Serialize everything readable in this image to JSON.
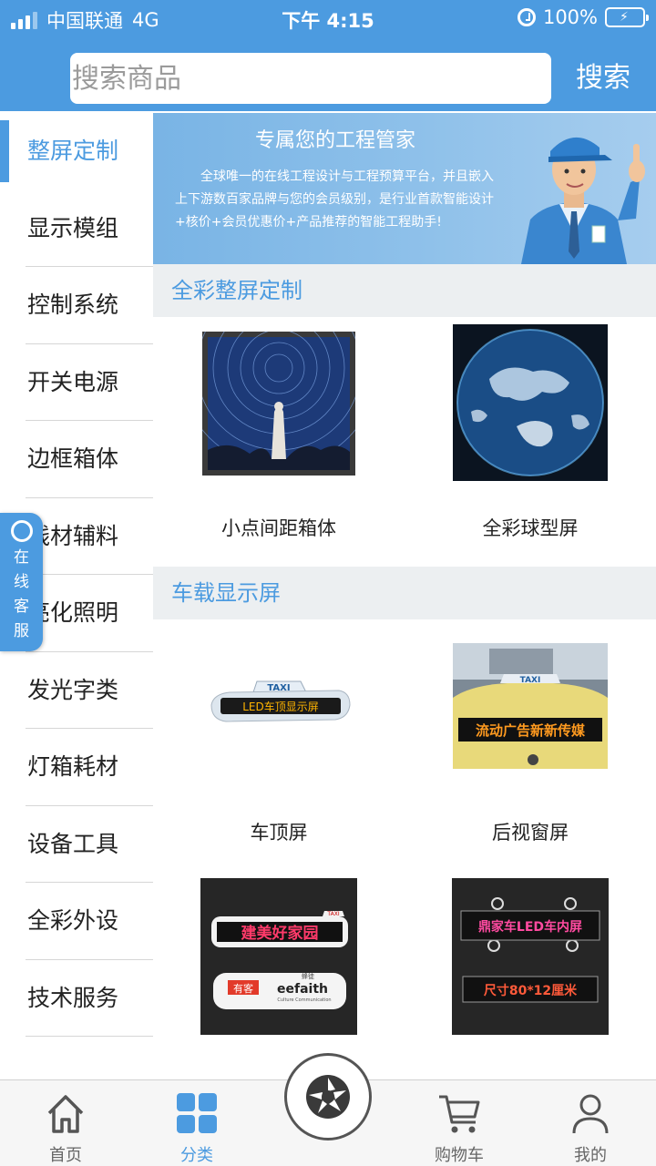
{
  "status_bar": {
    "carrier": "中国联通",
    "network": "4G",
    "time": "下午 4:15",
    "battery": "100%"
  },
  "search": {
    "placeholder": "搜索商品",
    "button_label": "搜索"
  },
  "sidebar": {
    "items": [
      {
        "label": "整屏定制",
        "active": true
      },
      {
        "label": "显示模组"
      },
      {
        "label": "控制系统"
      },
      {
        "label": "开关电源"
      },
      {
        "label": "边框箱体"
      },
      {
        "label": "线材辅料"
      },
      {
        "label": "亮化照明"
      },
      {
        "label": "发光字类"
      },
      {
        "label": "灯箱耗材"
      },
      {
        "label": "设备工具"
      },
      {
        "label": "全彩外设"
      },
      {
        "label": "技术服务"
      }
    ]
  },
  "online_service": {
    "chars": [
      "在",
      "线",
      "客",
      "服"
    ]
  },
  "banner": {
    "title": "专属您的工程管家",
    "text": "全球唯一的在线工程设计与工程预算平台，并且嵌入上下游数百家品牌与您的会员级别，是行业首款智能设计+核价+会员优惠价+产品推荐的智能工程助手!"
  },
  "sections": [
    {
      "title": "全彩整屏定制",
      "products": [
        {
          "name": "小点间距箱体"
        },
        {
          "name": "全彩球型屏"
        }
      ]
    },
    {
      "title": "车载显示屏",
      "products": [
        {
          "name": "车顶屏",
          "sign_top": "TAXI",
          "sign_text": "LED车顶显示屏"
        },
        {
          "name": "后视窗屏",
          "sign_top": "TAXI",
          "sign_text": "流动广告新新传媒"
        },
        {
          "name": "",
          "sign_top": "TAXI",
          "sign_text": "建美好家园",
          "sub_label": "有客",
          "brand": "eefaith",
          "brand_small": "蜂徒",
          "brand_sub": "Culture Communication"
        },
        {
          "name": "",
          "sign_text": "鼎家车LED车内屏",
          "sign_text2": "尺寸80*12厘米"
        }
      ]
    }
  ],
  "tabbar": {
    "tabs": [
      {
        "label": "首页",
        "icon": "home-icon"
      },
      {
        "label": "分类",
        "icon": "category-grid-icon",
        "active": true
      },
      {
        "label": "",
        "icon": "camera-aperture-icon"
      },
      {
        "label": "购物车",
        "icon": "cart-icon"
      },
      {
        "label": "我的",
        "icon": "user-icon"
      }
    ]
  },
  "colors": {
    "accent": "#4c9be0",
    "section_bg": "#eceff1"
  }
}
